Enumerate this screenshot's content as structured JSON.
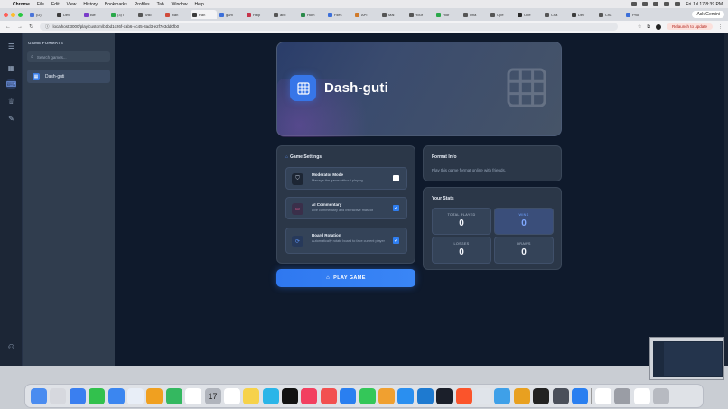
{
  "menubar": {
    "app": "Chrome",
    "items": [
      "File",
      "Edit",
      "View",
      "History",
      "Bookmarks",
      "Profiles",
      "Tab",
      "Window",
      "Help"
    ],
    "clock": "Fri Jul 17  8:39 PM"
  },
  "tabs": [
    {
      "label": "(D)",
      "color": "#4a74d9"
    },
    {
      "label": "Dev",
      "color": "#3c3c3c"
    },
    {
      "label": "Ble",
      "color": "#7a3cc9"
    },
    {
      "label": "(3) I",
      "color": "#2aa84a"
    },
    {
      "label": "Wiki",
      "color": "#555"
    },
    {
      "label": "Ran",
      "color": "#d04a3a"
    },
    {
      "label": "Ran",
      "color": "#3c3c3c",
      "active": true
    },
    {
      "label": "gam",
      "color": "#3c6fd9"
    },
    {
      "label": "Help",
      "color": "#c6344b"
    },
    {
      "label": "abc",
      "color": "#555"
    },
    {
      "label": "Hom",
      "color": "#2a8a4a"
    },
    {
      "label": "Files",
      "color": "#3c6fd9"
    },
    {
      "label": "API",
      "color": "#d07a2a"
    },
    {
      "label": "Mai",
      "color": "#555"
    },
    {
      "label": "Your",
      "color": "#555"
    },
    {
      "label": "Hidr",
      "color": "#2aa84a"
    },
    {
      "label": "Una",
      "color": "#555"
    },
    {
      "label": "Ope",
      "color": "#555"
    },
    {
      "label": "Ope",
      "color": "#2a2a2a"
    },
    {
      "label": "Cha",
      "color": "#555"
    },
    {
      "label": "Dev",
      "color": "#3c3c3c"
    },
    {
      "label": "Cha",
      "color": "#555"
    },
    {
      "label": "Pho",
      "color": "#3c6fd9"
    }
  ],
  "ask_gemini": "Ask Gemini",
  "url": "localhost:3000/play/custom/b1bd1c26f-cab6-4c45-8ad3-e2f7e3dd0fb0",
  "relaunch": "Relaunch to update",
  "sidebar": {
    "title": "GAME FORMATS",
    "search_placeholder": "Search games...",
    "items": [
      {
        "label": "Dash-guti"
      }
    ]
  },
  "hero": {
    "title": "Dash-guti"
  },
  "settings": {
    "title": "Game Settings",
    "items": [
      {
        "name": "Moderator Mode",
        "desc": "Manage the game without playing",
        "checked": false
      },
      {
        "name": "AI Commentary",
        "desc": "Live commentary and interactive mascot",
        "checked": true
      },
      {
        "name": "Board Rotation",
        "desc": "Automatically rotate board to face current player",
        "checked": true
      }
    ]
  },
  "play_button": "PLAY GAME",
  "format_info": {
    "title": "Format Info",
    "text": "Play this game format online with friends."
  },
  "stats": {
    "title": "Your Stats",
    "items": [
      {
        "label": "TOTAL PLAYED",
        "value": "0"
      },
      {
        "label": "WINS",
        "value": "0"
      },
      {
        "label": "LOSSES",
        "value": "0"
      },
      {
        "label": "DRAWS",
        "value": "0"
      }
    ]
  },
  "dock_calendar_day": "17",
  "colors": {
    "accent": "#2f7ef0",
    "background": "#0f1a2c",
    "panel": "#2b3748"
  }
}
